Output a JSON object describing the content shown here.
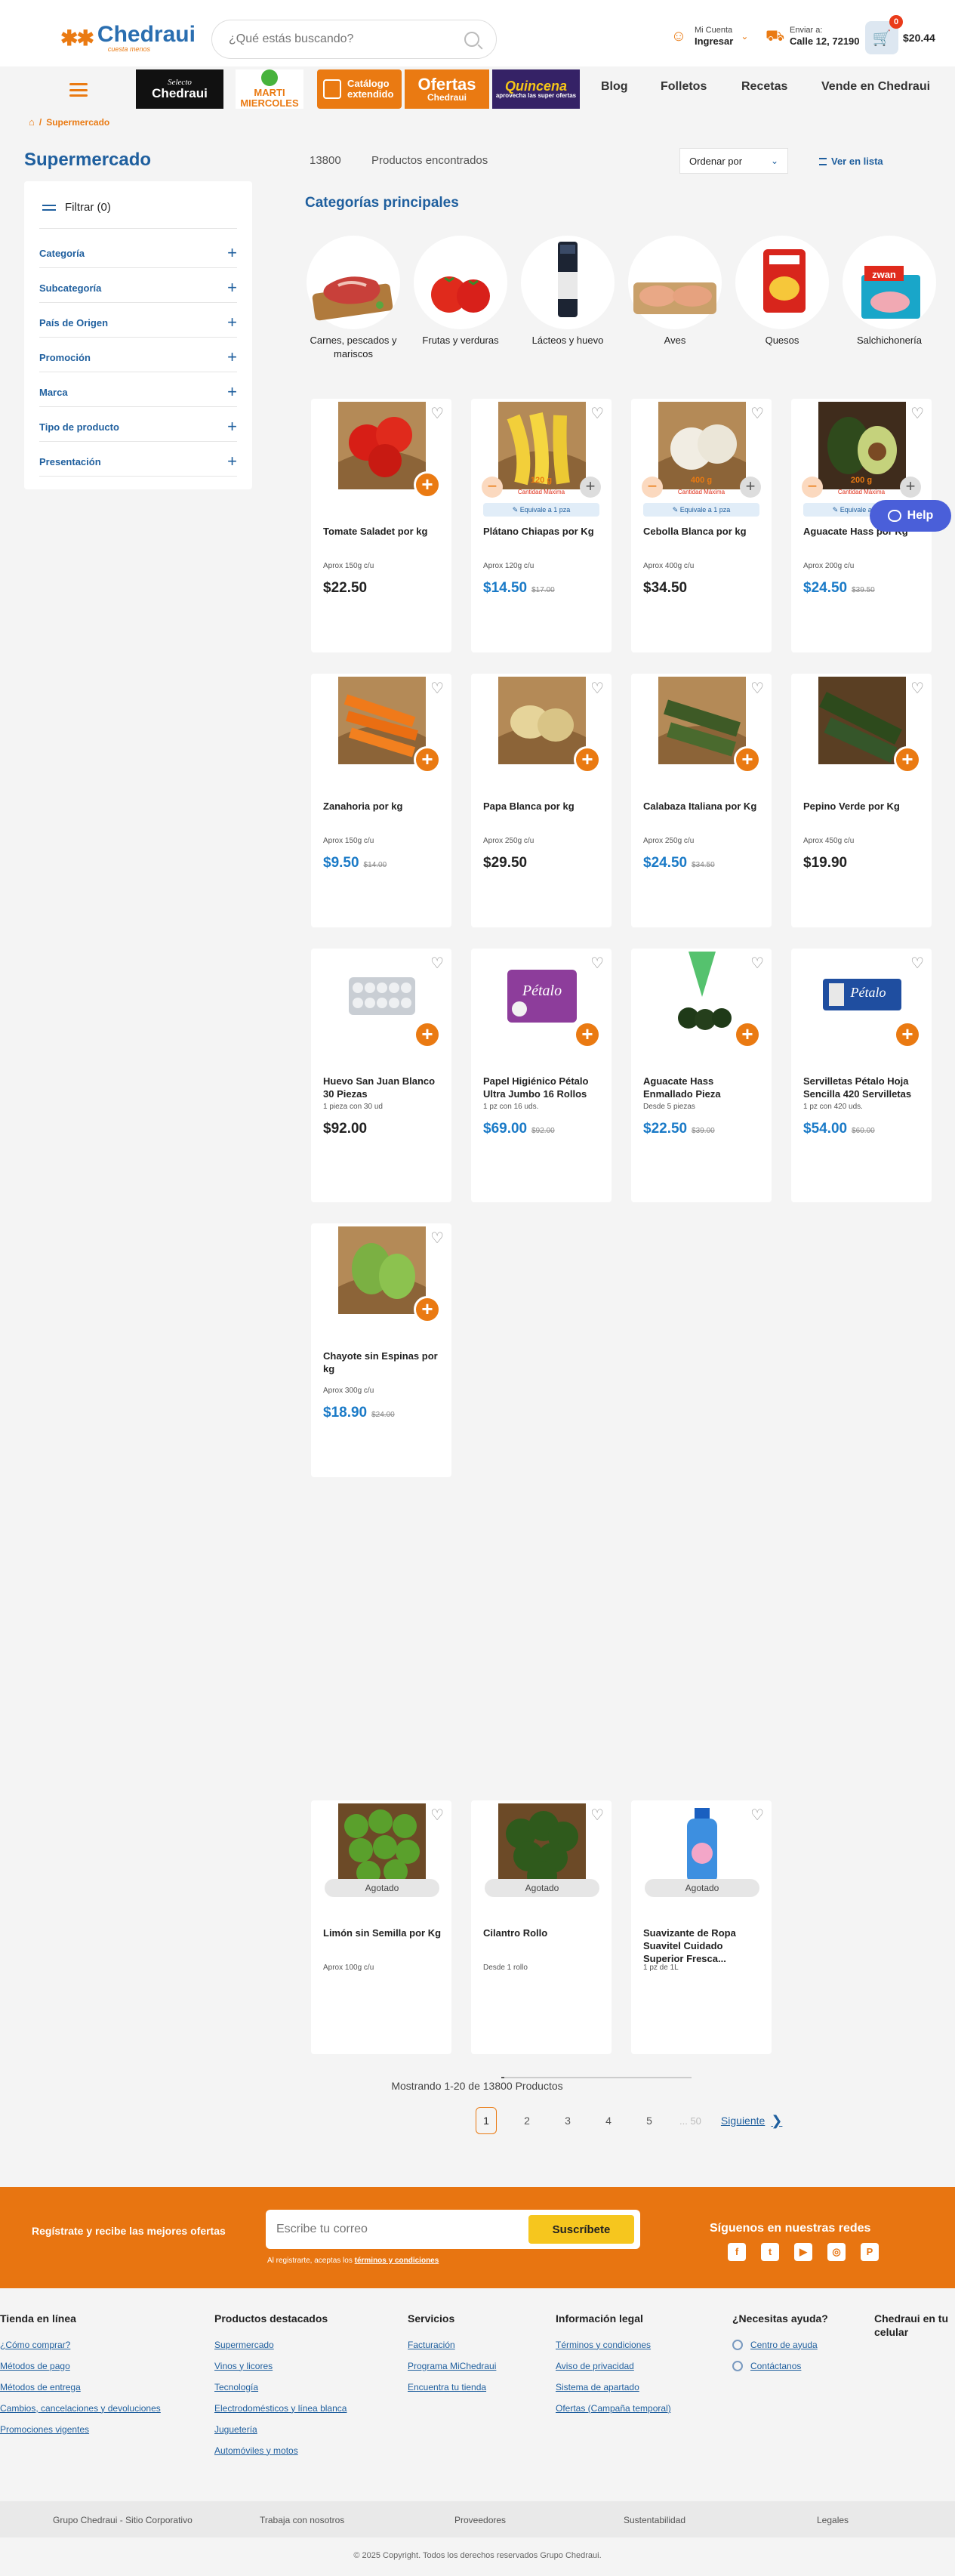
{
  "header": {
    "logo_text": "Chedraui",
    "logo_tagline": "cuesta menos",
    "search_placeholder": "¿Qué estás buscando?",
    "account_small": "Mi Cuenta",
    "account_label": "Ingresar",
    "ship_small": "Enviar a:",
    "ship_label": "Calle 12, 72190",
    "cart_count": "0",
    "cart_amount": "$20.44"
  },
  "promos": {
    "selecto_small": "Selecto",
    "selecto": "Chedraui",
    "marti_1": "MARTI",
    "marti_2": "MIERCOLES",
    "catalogo": "Catálogo extendido",
    "ofertas": "Ofertas",
    "ofertas_small": "Chedraui",
    "quincena": "Quincena",
    "quincena_small": "aprovecha las super ofertas"
  },
  "nav": [
    "Blog",
    "Folletos",
    "Recetas",
    "Vende en Chedraui"
  ],
  "breadcrumb": "Supermercado",
  "sidebar": {
    "title": "Supermercado",
    "filter": "Filtrar (0)",
    "items": [
      "Categoría",
      "Subcategoría",
      "País de Origen",
      "Promoción",
      "Marca",
      "Tipo de producto",
      "Presentación"
    ]
  },
  "results": {
    "count": "13800",
    "found": "Productos encontrados",
    "sort": "Ordenar por",
    "list_view": "Ver en lista"
  },
  "categories": {
    "title": "Categorías principales",
    "items": [
      "Carnes, pescados y mariscos",
      "Frutas y verduras",
      "Lácteos y huevo",
      "Aves",
      "Quesos",
      "Salchichonería"
    ]
  },
  "products": [
    {
      "name": "Tomate Saladet por kg",
      "sub": "Aprox 150g c/u",
      "price": "$22.50",
      "old": ""
    },
    {
      "name": "Plátano Chiapas por Kg",
      "sub": "Aprox 120g c/u",
      "price": "$14.50",
      "old": "$17.00",
      "qty": "120 g",
      "qty_note": "Cantidad Máxima",
      "equiv": "Equivale a 1 pza"
    },
    {
      "name": "Cebolla Blanca por kg",
      "sub": "Aprox 400g c/u",
      "price": "$34.50",
      "old": "",
      "qty": "400 g",
      "qty_note": "Cantidad Máxima",
      "equiv": "Equivale a 1 pza"
    },
    {
      "name": "Aguacate Hass por Kg",
      "sub": "Aprox 200g c/u",
      "price": "$24.50",
      "old": "$39.50",
      "qty": "200 g",
      "qty_note": "Cantidad Máxima",
      "equiv": "Equivale a 1 pza"
    },
    {
      "name": "Zanahoria por kg",
      "sub": "Aprox 150g c/u",
      "price": "$9.50",
      "old": "$14.00"
    },
    {
      "name": "Papa Blanca por kg",
      "sub": "Aprox 250g c/u",
      "price": "$29.50",
      "old": ""
    },
    {
      "name": "Calabaza Italiana por Kg",
      "sub": "Aprox 250g c/u",
      "price": "$24.50",
      "old": "$34.50"
    },
    {
      "name": "Pepino Verde por Kg",
      "sub": "Aprox 450g c/u",
      "price": "$19.90",
      "old": ""
    },
    {
      "name": "Huevo San Juan Blanco 30 Piezas",
      "sub": "1 pieza con 30 ud",
      "price": "$92.00",
      "old": ""
    },
    {
      "name": "Papel Higiénico Pétalo Ultra Jumbo 16 Rollos",
      "sub": "1 pz con 16 uds.",
      "price": "$69.00",
      "old": "$92.00"
    },
    {
      "name": "Aguacate Hass Enmallado Pieza",
      "sub": "Desde 5 piezas",
      "price": "$22.50",
      "old": "$39.00"
    },
    {
      "name": "Servilletas Pétalo Hoja Sencilla 420 Servilletas",
      "sub": "1 pz con 420 uds.",
      "price": "$54.00",
      "old": "$60.00"
    },
    {
      "name": "Chayote sin Espinas por kg",
      "sub": "Aprox 300g c/u",
      "price": "$18.90",
      "old": "$24.00"
    },
    {
      "name": "Limón sin Semilla por Kg",
      "sub": "Aprox 100g c/u",
      "status": "Agotado"
    },
    {
      "name": "Cilantro Rollo",
      "sub": "Desde 1 rollo",
      "status": "Agotado"
    },
    {
      "name": "Suavizante de Ropa Suavitel Cuidado Superior Fresca...",
      "sub": "1 pz de 1L",
      "status": "Agotado"
    }
  ],
  "help": "Help",
  "pagination": {
    "showing": "Mostrando 1-20 de 13800 Productos",
    "pages": [
      "1",
      "2",
      "3",
      "4",
      "5"
    ],
    "ellipsis": "... 50",
    "next": "Siguiente"
  },
  "newsletter": {
    "title": "Regístrate y recibe las mejores ofertas",
    "placeholder": "Escribe tu correo",
    "button": "Suscríbete",
    "note": "Al registrarte, aceptas los",
    "note_link": "términos y condiciones",
    "follow": "Síguenos en nuestras redes",
    "socials": [
      "f",
      "t",
      "▶",
      "◎",
      "P"
    ]
  },
  "footer": {
    "tienda": {
      "title": "Tienda en línea",
      "links": [
        "¿Cómo comprar?",
        "Métodos de pago",
        "Métodos de entrega",
        "Cambios, cancelaciones y devoluciones",
        "Promociones vigentes"
      ]
    },
    "productos": {
      "title": "Productos destacados",
      "links": [
        "Supermercado",
        "Vinos y licores",
        "Tecnología",
        "Electrodomésticos y línea blanca",
        "Juguetería",
        "Automóviles y motos"
      ]
    },
    "servicios": {
      "title": "Servicios",
      "links": [
        "Facturación",
        "Programa MiChedraui",
        "Encuentra tu tienda"
      ]
    },
    "legal": {
      "title": "Información legal",
      "links": [
        "Términos y condiciones",
        "Aviso de privacidad",
        "Sistema de apartado",
        "Ofertas (Campaña temporal)"
      ]
    },
    "ayuda": {
      "title": "¿Necesitas ayuda?",
      "links": [
        "Centro de ayuda",
        "Contáctanos"
      ]
    },
    "celular": {
      "title": "Chedraui en tu celular"
    },
    "bottom": [
      "Grupo Chedraui - Sitio Corporativo",
      "Trabaja con nosotros",
      "Proveedores",
      "Sustentabilidad",
      "Legales"
    ],
    "copyright": "© 2025 Copyright. Todos los derechos reservados Grupo Chedraui."
  },
  "colors": {
    "brand_orange": "#ea7a12",
    "brand_blue": "#1f5f9e",
    "sale_blue": "#1a7ac7",
    "help_purple": "#4a5fd9"
  }
}
